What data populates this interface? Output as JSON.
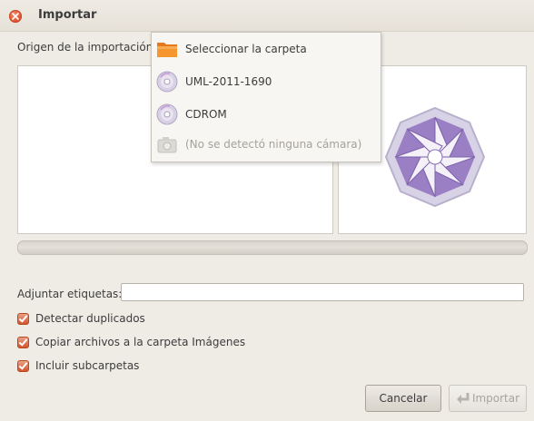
{
  "window": {
    "title": "Importar"
  },
  "source": {
    "label": "Origen de la importación:",
    "menu_items": [
      {
        "label": "Seleccionar la carpeta",
        "icon": "folder-icon",
        "enabled": true
      },
      {
        "label": "UML-2011-1690",
        "icon": "disc-icon",
        "enabled": true
      },
      {
        "label": "CDROM",
        "icon": "disc-icon",
        "enabled": true
      },
      {
        "label": "(No se detectó ninguna cámara)",
        "icon": "camera-icon",
        "enabled": false
      }
    ]
  },
  "tags": {
    "label": "Adjuntar etiquetas:",
    "value": ""
  },
  "options": [
    {
      "label": "Detectar duplicados",
      "checked": true
    },
    {
      "label": "Copiar archivos a la carpeta Imágenes",
      "checked": true
    },
    {
      "label": "Incluir subcarpetas",
      "checked": true
    }
  ],
  "buttons": {
    "cancel": "Cancelar",
    "import": "Importar"
  },
  "colors": {
    "accent": "#d2542c",
    "aperture": "#9b7fc4",
    "folder": "#f08a24"
  }
}
